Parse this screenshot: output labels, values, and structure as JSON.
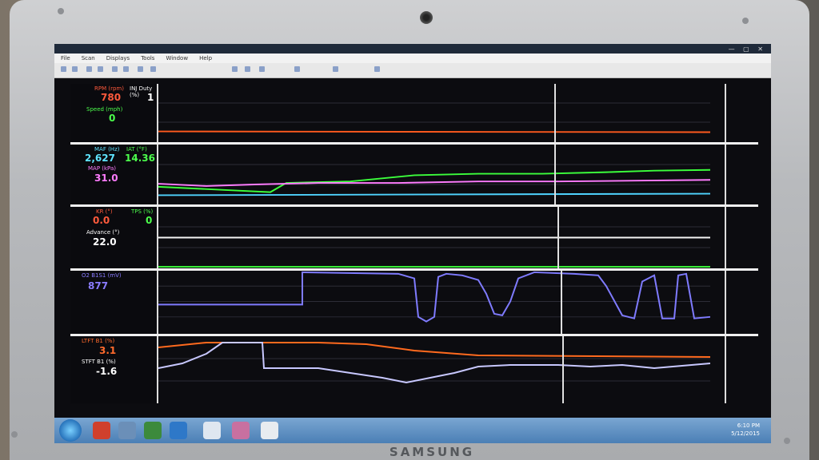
{
  "device": {
    "brand": "SAMSUNG"
  },
  "window": {
    "menu": [
      "File",
      "Scan",
      "Displays",
      "Tools",
      "Window",
      "Help"
    ]
  },
  "panels": [
    {
      "labels": [
        {
          "text": "RPM (rpm)",
          "value": "780",
          "color": "#ff5a3c"
        },
        {
          "text": "Speed (mph)",
          "value": "0",
          "color": "#4cff4c"
        },
        {
          "text": "INJ Duty (%)",
          "value": "1",
          "color": "#ffffff"
        }
      ]
    },
    {
      "labels": [
        {
          "text": "MAF (Hz)",
          "value": "2,627",
          "color": "#5fe4ff"
        },
        {
          "text": "MAP (kPa)",
          "value": "31.0",
          "color": "#ff7cff"
        },
        {
          "text": "IAT (°F)",
          "value": "14.36",
          "color": "#4cff4c"
        }
      ]
    },
    {
      "labels": [
        {
          "text": "KR (°)",
          "value": "0.0",
          "color": "#ff5a3c"
        },
        {
          "text": "Advance (°)",
          "value": "22.0",
          "color": "#ffffff"
        },
        {
          "text": "TPS (%)",
          "value": "0",
          "color": "#4cff4c"
        }
      ]
    },
    {
      "labels": [
        {
          "text": "O2 B1S1 (mV)",
          "value": "877",
          "color": "#8a7cff"
        }
      ]
    },
    {
      "labels": [
        {
          "text": "LTFT B1 (%)",
          "value": "3.1",
          "color": "#ff6a2c"
        },
        {
          "text": "STFT B1 (%)",
          "value": "-1.6",
          "color": "#ffffff"
        }
      ]
    }
  ],
  "taskbar": {
    "time": "6:10 PM",
    "date": "5/12/2015"
  }
}
